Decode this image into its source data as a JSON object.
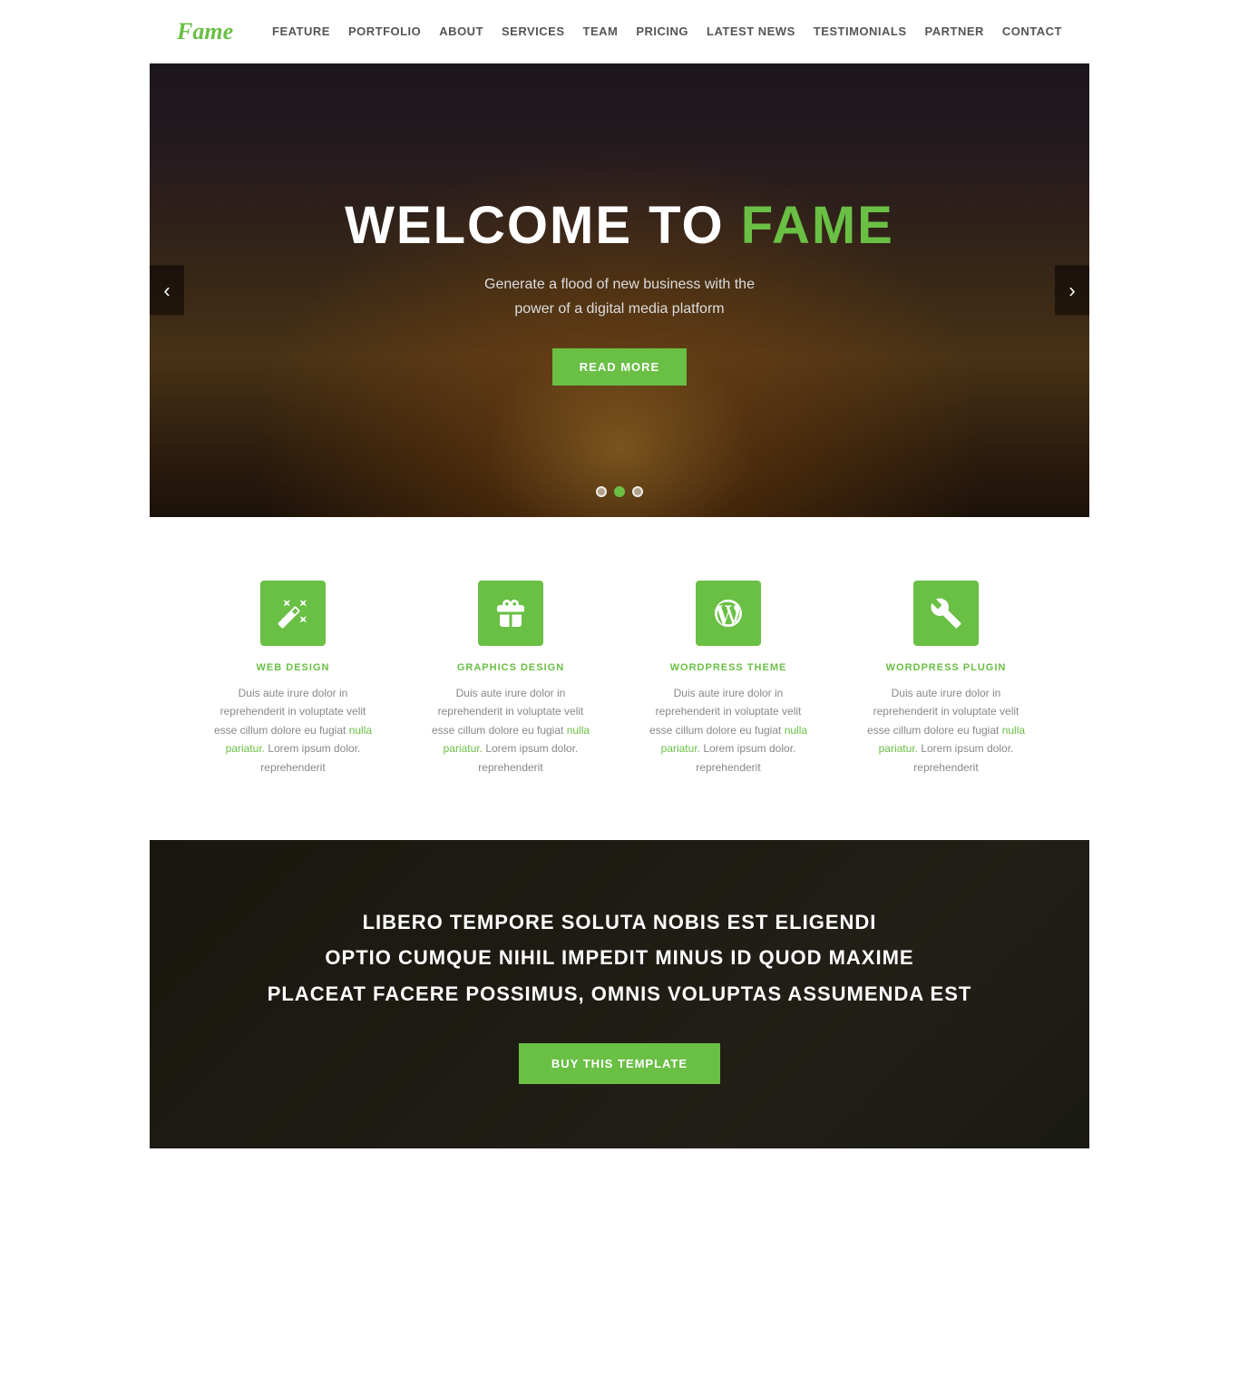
{
  "nav": {
    "logo": "Fame",
    "links": [
      {
        "label": "FEATURE",
        "href": "#"
      },
      {
        "label": "PORTFOLIO",
        "href": "#"
      },
      {
        "label": "ABOUT",
        "href": "#"
      },
      {
        "label": "SERVICES",
        "href": "#"
      },
      {
        "label": "TEAM",
        "href": "#"
      },
      {
        "label": "PRICING",
        "href": "#"
      },
      {
        "label": "LATEST NEWS",
        "href": "#"
      },
      {
        "label": "TESTIMONIALS",
        "href": "#"
      },
      {
        "label": "PARTNER",
        "href": "#"
      },
      {
        "label": "CONTACT",
        "href": "#"
      }
    ]
  },
  "hero": {
    "title_prefix": "WELCOME TO ",
    "title_brand": "FAME",
    "subtitle_line1": "Generate a flood of new business with the",
    "subtitle_line2": "power of a digital media platform",
    "cta_label": "READ MORE",
    "prev_label": "‹",
    "next_label": "›",
    "dots": [
      {
        "active": false
      },
      {
        "active": true
      },
      {
        "active": false
      }
    ]
  },
  "features": {
    "items": [
      {
        "title": "WEB DESIGN",
        "desc_plain": "Duis aute irure dolor in reprehenderit in voluptate velit esse cillum dolore eu fugiat nulla pariatur. Lorem ipsum dolor. reprehenderit",
        "icon": "wand"
      },
      {
        "title": "GRAPHICS DESIGN",
        "desc_plain": "Duis aute irure dolor in reprehenderit in voluptate velit esse cillum dolore eu fugiat nulla pariatur. Lorem ipsum dolor. reprehenderit",
        "icon": "gift"
      },
      {
        "title": "WORDPRESS THEME",
        "desc_plain": "Duis aute irure dolor in reprehenderit in voluptate velit esse cillum dolore eu fugiat nulla pariatur. Lorem ipsum dolor. reprehenderit",
        "icon": "wordpress"
      },
      {
        "title": "WORDPRESS PLUGIN",
        "desc_plain": "Duis aute irure dolor in reprehenderit in voluptate velit esse cillum dolore eu fugiat nulla pariatur. Lorem ipsum dolor. reprehenderit",
        "icon": "wrench"
      }
    ]
  },
  "cta": {
    "line1": "LIBERO TEMPORE SOLUTA NOBIS EST ELIGENDI",
    "line2": "OPTIO CUMQUE NIHIL IMPEDIT MINUS ID QUOD MAXIME",
    "line3": "PLACEAT FACERE POSSIMUS, OMNIS VOLUPTAS ASSUMENDA EST",
    "btn_label": "BUY THIS TEMPLATE"
  }
}
